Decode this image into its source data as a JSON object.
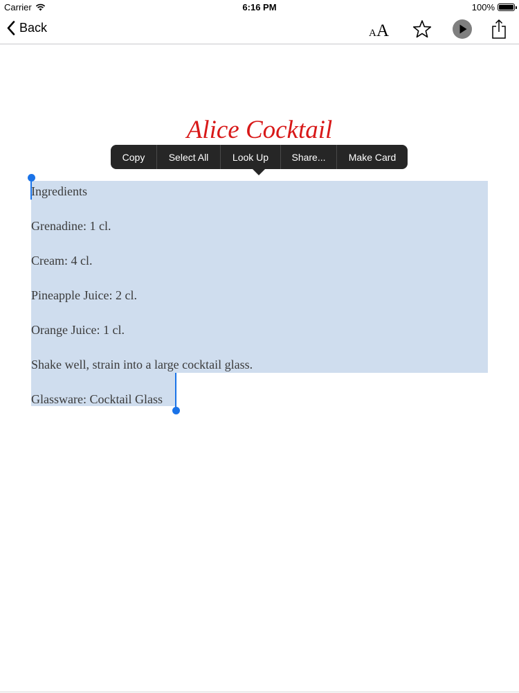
{
  "status_bar": {
    "carrier": "Carrier",
    "time": "6:16 PM",
    "battery": "100%"
  },
  "nav": {
    "back_label": "Back",
    "icons": [
      "chevron-left-icon",
      "font-size-icon",
      "star-icon",
      "play-icon",
      "share-icon"
    ]
  },
  "title": "Alice Cocktail",
  "context_menu": {
    "items": [
      "Copy",
      "Select All",
      "Look Up",
      "Share...",
      "Make Card"
    ]
  },
  "content": {
    "lines": [
      "Ingredients",
      "Grenadine: 1 cl.",
      "Cream: 4 cl.",
      "Pineapple Juice: 2 cl.",
      "Orange Juice: 1 cl.",
      "Shake well, strain into a large cocktail glass.",
      "Glassware: Cocktail Glass"
    ]
  },
  "colors": {
    "title": "#d81818",
    "selection": "#cfddee",
    "selection_handle": "#1a73e8",
    "menu_background": "#262626"
  }
}
